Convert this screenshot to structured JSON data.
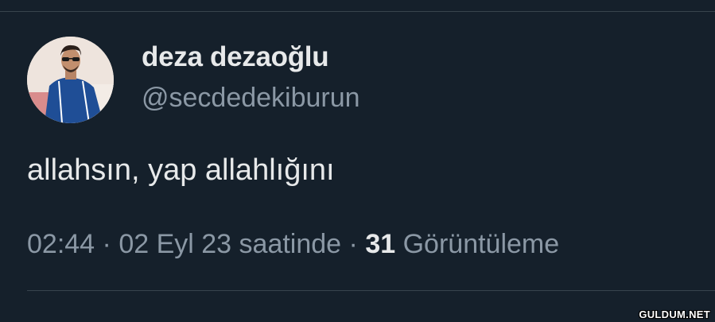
{
  "tweet": {
    "display_name": "deza dezaoğlu",
    "handle": "@secdedekiburun",
    "text": "allahsın, yap allahlığını",
    "time": "02:44",
    "separator": "·",
    "date": "02 Eyl 23 saatinde",
    "views_count": "31",
    "views_label": "Görüntüleme"
  },
  "watermark": "GULDUM.NET",
  "colors": {
    "background": "#15202b",
    "primary_text": "#e7e9ea",
    "secondary_text": "#8b98a5",
    "divider": "#38444d"
  }
}
